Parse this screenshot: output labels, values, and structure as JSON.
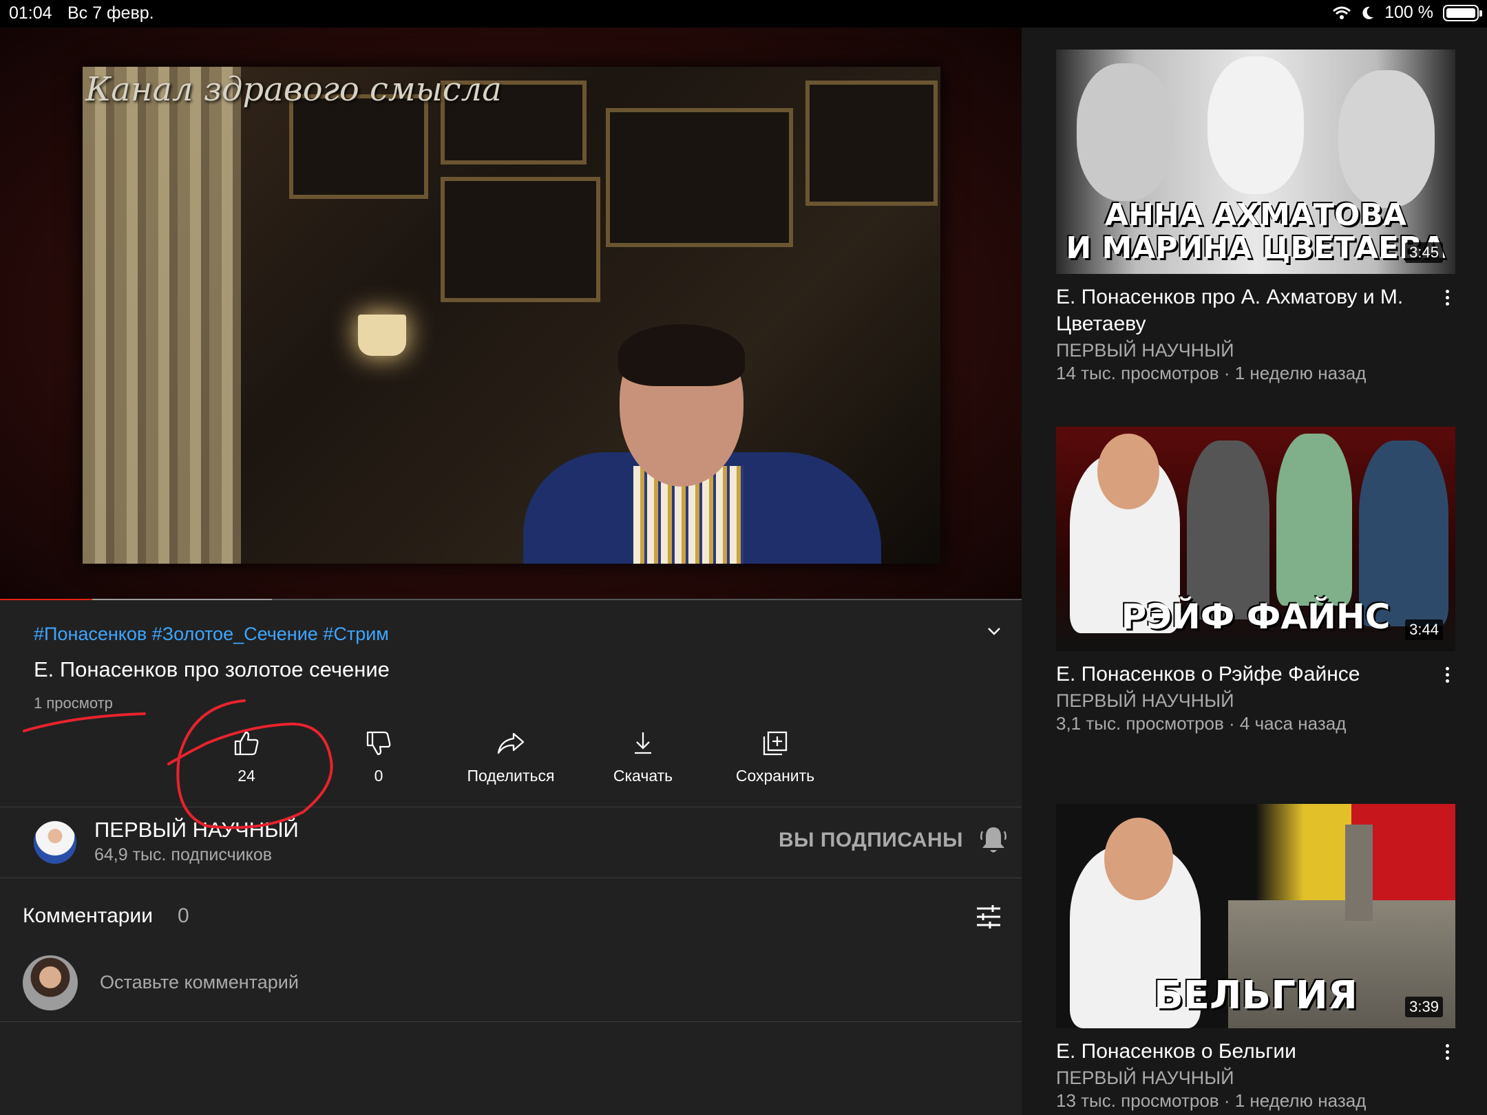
{
  "status_bar": {
    "time": "01:04",
    "date": "Вс 7 февр.",
    "battery": "100 %"
  },
  "player": {
    "overlay_text": "Канал здравого смысла",
    "progress": {
      "played_fraction": 0.09,
      "buffered_fraction": 0.266
    }
  },
  "video": {
    "hashtags": "#Понасенков #Золотое_Сечение #Стрим",
    "title": "Е. Понасенков про золотое сечение",
    "views": "1 просмотр"
  },
  "actions": {
    "like": "24",
    "dislike": "0",
    "share": "Поделиться",
    "download": "Скачать",
    "save": "Сохранить"
  },
  "channel": {
    "name": "ПЕРВЫЙ НАУЧНЫЙ",
    "subscribers": "64,9 тыс. подписчиков",
    "subscribed_label": "ВЫ ПОДПИСАНЫ"
  },
  "comments": {
    "title": "Комментарии",
    "count": "0",
    "placeholder": "Оставьте комментарий"
  },
  "sidebar": {
    "items": [
      {
        "thumb_line1": "АННА АХМАТОВА",
        "thumb_line2": "И МАРИНА ЦВЕТАЕВА",
        "duration": "3:45",
        "title": "Е. Понасенков про А. Ахматову и М. Цветаеву",
        "channel": "ПЕРВЫЙ НАУЧНЫЙ",
        "meta": "14 тыс. просмотров · 1 неделю назад"
      },
      {
        "thumb_line1": "РЭЙФ ФАЙНС",
        "duration": "3:44",
        "title": "Е. Понасенков о Рэйфе Файнсе",
        "channel": "ПЕРВЫЙ НАУЧНЫЙ",
        "meta": "3,1 тыс. просмотров · 4 часа назад"
      },
      {
        "thumb_line1": "БЕЛЬГИЯ",
        "duration": "3:39",
        "title": "Е. Понасенков о Бельгии",
        "channel": "ПЕРВЫЙ НАУЧНЫЙ",
        "meta": "13 тыс. просмотров · 1 неделю назад"
      }
    ]
  },
  "colors": {
    "background": "#212121",
    "link": "#3ea6ff",
    "progress": "#e62117",
    "annotation": "#e8232e"
  }
}
